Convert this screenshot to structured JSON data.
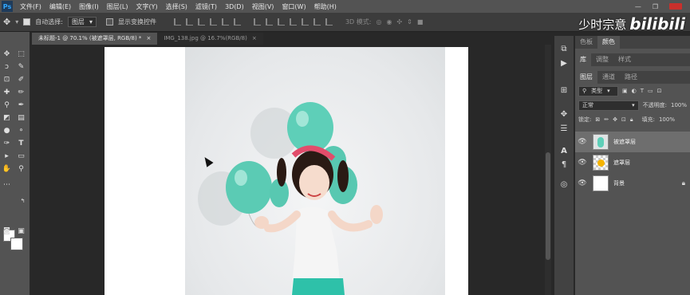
{
  "menubar": {
    "logo": "Ps",
    "items": [
      "文件(F)",
      "编辑(E)",
      "图像(I)",
      "图层(L)",
      "文字(Y)",
      "选择(S)",
      "滤镜(T)",
      "3D(D)",
      "视图(V)",
      "窗口(W)",
      "帮助(H)"
    ]
  },
  "options": {
    "auto_select_label": "自动选择:",
    "auto_select_value": "图层",
    "show_transform_label": "显示变换控件",
    "mode_3d_label": "3D 模式:"
  },
  "watermark": {
    "text": "少时宗意",
    "logo": "bilibili"
  },
  "tabs": [
    {
      "label": "未标题-1 @ 70.1% (被遮罩层, RGB/8) *"
    },
    {
      "label": "IMG_138.jpg @ 16.7%(RGB/8)"
    }
  ],
  "right_panel": {
    "tabs_row1": [
      "色板",
      "颜色"
    ],
    "tabs_row2": [
      "库",
      "调整",
      "样式"
    ],
    "tabs_row3": [
      "图层",
      "通道",
      "路径"
    ],
    "kind_label": "类型",
    "blend_mode": "正常",
    "opacity_label": "不透明度:",
    "opacity_value": "100%",
    "lock_label": "锁定:",
    "fill_label": "填充:",
    "fill_value": "100%",
    "layers": [
      {
        "name": "被遮罩层"
      },
      {
        "name": "遮罩层"
      },
      {
        "name": "背景"
      }
    ]
  },
  "colors": {
    "balloon": "#5ecfb8",
    "accent_red": "#c9302c"
  }
}
